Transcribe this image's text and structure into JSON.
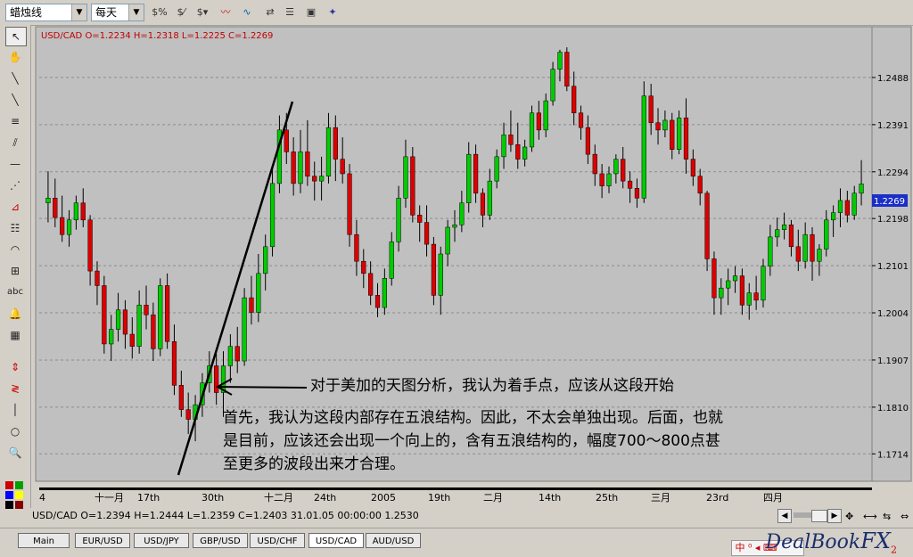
{
  "toolbar": {
    "chart_type": "蜡烛线",
    "period": "每天",
    "icons": [
      "dollar-percent-icon",
      "dollar-slash-icon",
      "dollar-bars-icon",
      "line-indicator-icon",
      "wave-indicator-icon",
      "swap-icon",
      "list-icon",
      "square-icon",
      "window-icon",
      "printer-icon",
      "tools-icon"
    ]
  },
  "left_tools": [
    "cursor-icon",
    "hand-icon",
    "trendline-icon",
    "ray-icon",
    "channel-icon",
    "fan-icon",
    "horizontal-line-icon",
    "gann-fan-icon",
    "fibonacci-icon",
    "fib-retracement-icon",
    "arc-icon",
    "text-icon",
    "alert-bell-icon",
    "calculator-icon",
    "up-down-arrow-icon",
    "zigzag-icon",
    "vertical-line-icon",
    "circle-icon",
    "zoom-icon",
    "color-palette-icon"
  ],
  "chart": {
    "header": "USD/CAD O=1.2234 H=1.2318 L=1.2225 C=1.2269",
    "current_price": "1.2269",
    "annotation_arrow": "对于美加的天图分析，我认为着手点，应该从这段开始",
    "annotation_body": [
      "首先，我认为这段内部存在五浪结构。因此，不太会单独出现。后面，也就",
      "是目前，应该还会出现一个向上的，含有五浪结构的，幅度700～800点甚",
      "至更多的波段出来才合理。"
    ]
  },
  "chart_data": {
    "type": "candlestick",
    "symbol": "USD/CAD",
    "ylim": [
      1.1665,
      1.2585
    ],
    "y_ticks": [
      1.2488,
      1.2391,
      1.2294,
      1.2198,
      1.2101,
      1.2004,
      1.1907,
      1.181,
      1.1714
    ],
    "x_ticks": [
      "4",
      "十一月",
      "17th",
      "30th",
      "十二月",
      "24th",
      "2005",
      "19th",
      "二月",
      "14th",
      "25th",
      "三月",
      "23rd",
      "四月"
    ],
    "grid": true,
    "up_color": "#00cc00",
    "down_color": "#dd0000",
    "candles": [
      [
        1.223,
        1.2295,
        1.219,
        1.224
      ],
      [
        1.224,
        1.228,
        1.218,
        1.22
      ],
      [
        1.22,
        1.2245,
        1.215,
        1.2165
      ],
      [
        1.2165,
        1.2215,
        1.214,
        1.2195
      ],
      [
        1.2195,
        1.2245,
        1.2175,
        1.223
      ],
      [
        1.223,
        1.226,
        1.218,
        1.2195
      ],
      [
        1.2195,
        1.2205,
        1.206,
        1.209
      ],
      [
        1.209,
        1.211,
        1.202,
        1.206
      ],
      [
        1.206,
        1.208,
        1.192,
        1.194
      ],
      [
        1.194,
        1.2,
        1.1905,
        1.197
      ],
      [
        1.197,
        1.2045,
        1.1945,
        1.201
      ],
      [
        1.201,
        1.203,
        1.193,
        1.196
      ],
      [
        1.196,
        1.1995,
        1.191,
        1.1935
      ],
      [
        1.1935,
        1.205,
        1.192,
        1.202
      ],
      [
        1.202,
        1.206,
        1.197,
        1.2
      ],
      [
        1.2,
        1.2025,
        1.1905,
        1.193
      ],
      [
        1.193,
        1.2075,
        1.1915,
        1.206
      ],
      [
        1.206,
        1.2085,
        1.193,
        1.1945
      ],
      [
        1.1945,
        1.198,
        1.1835,
        1.1855
      ],
      [
        1.1855,
        1.1885,
        1.179,
        1.1805
      ],
      [
        1.1805,
        1.184,
        1.1755,
        1.1785
      ],
      [
        1.1785,
        1.1835,
        1.174,
        1.1815
      ],
      [
        1.1815,
        1.188,
        1.179,
        1.186
      ],
      [
        1.186,
        1.1925,
        1.184,
        1.1895
      ],
      [
        1.1895,
        1.192,
        1.1815,
        1.184
      ],
      [
        1.184,
        1.1925,
        1.179,
        1.1895
      ],
      [
        1.1895,
        1.196,
        1.186,
        1.1935
      ],
      [
        1.1935,
        1.1975,
        1.188,
        1.1905
      ],
      [
        1.1905,
        1.2055,
        1.1895,
        1.2035
      ],
      [
        1.2035,
        1.208,
        1.198,
        1.2005
      ],
      [
        1.2005,
        1.2125,
        1.1985,
        1.2085
      ],
      [
        1.2085,
        1.2165,
        1.205,
        1.214
      ],
      [
        1.214,
        1.2305,
        1.212,
        1.227
      ],
      [
        1.227,
        1.241,
        1.225,
        1.238
      ],
      [
        1.238,
        1.2415,
        1.231,
        1.2335
      ],
      [
        1.2335,
        1.2365,
        1.2245,
        1.227
      ],
      [
        1.227,
        1.238,
        1.225,
        1.2335
      ],
      [
        1.2335,
        1.24,
        1.2265,
        1.2285
      ],
      [
        1.2285,
        1.2315,
        1.2235,
        1.2275
      ],
      [
        1.2275,
        1.2325,
        1.2235,
        1.2285
      ],
      [
        1.2285,
        1.2415,
        1.227,
        1.2385
      ],
      [
        1.2385,
        1.241,
        1.2275,
        1.232
      ],
      [
        1.232,
        1.2365,
        1.227,
        1.229
      ],
      [
        1.229,
        1.231,
        1.214,
        1.2165
      ],
      [
        1.2165,
        1.2195,
        1.208,
        1.211
      ],
      [
        1.211,
        1.2135,
        1.2055,
        1.2085
      ],
      [
        1.2085,
        1.211,
        1.202,
        1.204
      ],
      [
        1.204,
        1.2065,
        1.1995,
        1.2015
      ],
      [
        1.2015,
        1.2095,
        1.2,
        1.2075
      ],
      [
        1.2075,
        1.217,
        1.206,
        1.215
      ],
      [
        1.215,
        1.2265,
        1.213,
        1.224
      ],
      [
        1.224,
        1.236,
        1.222,
        1.2325
      ],
      [
        1.2325,
        1.2345,
        1.219,
        1.2205
      ],
      [
        1.2205,
        1.2225,
        1.215,
        1.219
      ],
      [
        1.219,
        1.2225,
        1.212,
        1.2145
      ],
      [
        1.2145,
        1.216,
        1.202,
        1.204
      ],
      [
        1.204,
        1.214,
        1.2,
        1.2125
      ],
      [
        1.2125,
        1.2195,
        1.21,
        1.218
      ],
      [
        1.218,
        1.2215,
        1.215,
        1.2185
      ],
      [
        1.2185,
        1.2255,
        1.217,
        1.223
      ],
      [
        1.223,
        1.2355,
        1.221,
        1.233
      ],
      [
        1.233,
        1.235,
        1.223,
        1.225
      ],
      [
        1.225,
        1.226,
        1.218,
        1.2205
      ],
      [
        1.2205,
        1.23,
        1.2195,
        1.2275
      ],
      [
        1.2275,
        1.234,
        1.226,
        1.2325
      ],
      [
        1.2325,
        1.2395,
        1.23,
        1.237
      ],
      [
        1.237,
        1.242,
        1.2335,
        1.235
      ],
      [
        1.235,
        1.2395,
        1.23,
        1.232
      ],
      [
        1.232,
        1.236,
        1.2305,
        1.2345
      ],
      [
        1.2345,
        1.243,
        1.2335,
        1.2415
      ],
      [
        1.2415,
        1.244,
        1.236,
        1.238
      ],
      [
        1.238,
        1.2455,
        1.2365,
        1.244
      ],
      [
        1.244,
        1.252,
        1.243,
        1.2505
      ],
      [
        1.2505,
        1.2545,
        1.248,
        1.254
      ],
      [
        1.254,
        1.255,
        1.246,
        1.247
      ],
      [
        1.247,
        1.25,
        1.239,
        1.2415
      ],
      [
        1.2415,
        1.243,
        1.236,
        1.2385
      ],
      [
        1.2385,
        1.241,
        1.231,
        1.233
      ],
      [
        1.233,
        1.235,
        1.2265,
        1.229
      ],
      [
        1.229,
        1.231,
        1.224,
        1.2265
      ],
      [
        1.2265,
        1.2305,
        1.225,
        1.229
      ],
      [
        1.229,
        1.233,
        1.227,
        1.232
      ],
      [
        1.232,
        1.2345,
        1.226,
        1.2275
      ],
      [
        1.2275,
        1.2295,
        1.223,
        1.226
      ],
      [
        1.226,
        1.228,
        1.222,
        1.224
      ],
      [
        1.224,
        1.248,
        1.223,
        1.245
      ],
      [
        1.245,
        1.2475,
        1.237,
        1.2395
      ],
      [
        1.2395,
        1.2425,
        1.235,
        1.238
      ],
      [
        1.238,
        1.242,
        1.2365,
        1.24
      ],
      [
        1.24,
        1.2415,
        1.232,
        1.234
      ],
      [
        1.234,
        1.242,
        1.233,
        1.2405
      ],
      [
        1.2405,
        1.2445,
        1.229,
        1.232
      ],
      [
        1.232,
        1.234,
        1.2265,
        1.2285
      ],
      [
        1.2285,
        1.23,
        1.2225,
        1.225
      ],
      [
        1.225,
        1.2255,
        1.209,
        1.2115
      ],
      [
        1.2115,
        1.213,
        1.2,
        1.2035
      ],
      [
        1.2035,
        1.2075,
        1.2,
        1.2055
      ],
      [
        1.2055,
        1.2095,
        1.202,
        1.207
      ],
      [
        1.207,
        1.21,
        1.2045,
        1.208
      ],
      [
        1.208,
        1.2095,
        1.2,
        1.202
      ],
      [
        1.202,
        1.2065,
        1.199,
        1.2045
      ],
      [
        1.2045,
        1.208,
        1.201,
        1.203
      ],
      [
        1.203,
        1.2115,
        1.2015,
        1.21
      ],
      [
        1.21,
        1.2185,
        1.208,
        1.216
      ],
      [
        1.216,
        1.22,
        1.214,
        1.2175
      ],
      [
        1.2175,
        1.221,
        1.2155,
        1.2185
      ],
      [
        1.2185,
        1.2195,
        1.212,
        1.214
      ],
      [
        1.214,
        1.2175,
        1.209,
        1.211
      ],
      [
        1.211,
        1.219,
        1.2095,
        1.2165
      ],
      [
        1.2165,
        1.218,
        1.207,
        1.211
      ],
      [
        1.211,
        1.2145,
        1.208,
        1.2135
      ],
      [
        1.2135,
        1.2215,
        1.212,
        1.2195
      ],
      [
        1.2195,
        1.2225,
        1.216,
        1.221
      ],
      [
        1.221,
        1.226,
        1.218,
        1.2235
      ],
      [
        1.2235,
        1.2255,
        1.219,
        1.2205
      ],
      [
        1.2205,
        1.2265,
        1.2195,
        1.225
      ],
      [
        1.225,
        1.2318,
        1.2225,
        1.2269
      ]
    ],
    "trendline_drawn": true
  },
  "status": {
    "text": "USD/CAD O=1.2394 H=1.2444 L=1.2359 C=1.2403   31.01.05 00:00:00 1.2530"
  },
  "tabs": [
    "Main",
    "EUR/USD",
    "USD/JPY",
    "GBP/USD",
    "USD/CHF",
    "USD/CAD",
    "AUD/USD"
  ],
  "active_tab": "USD/CAD",
  "brand": {
    "name": "DealBook",
    "suffix": "FX",
    "version": "2"
  }
}
